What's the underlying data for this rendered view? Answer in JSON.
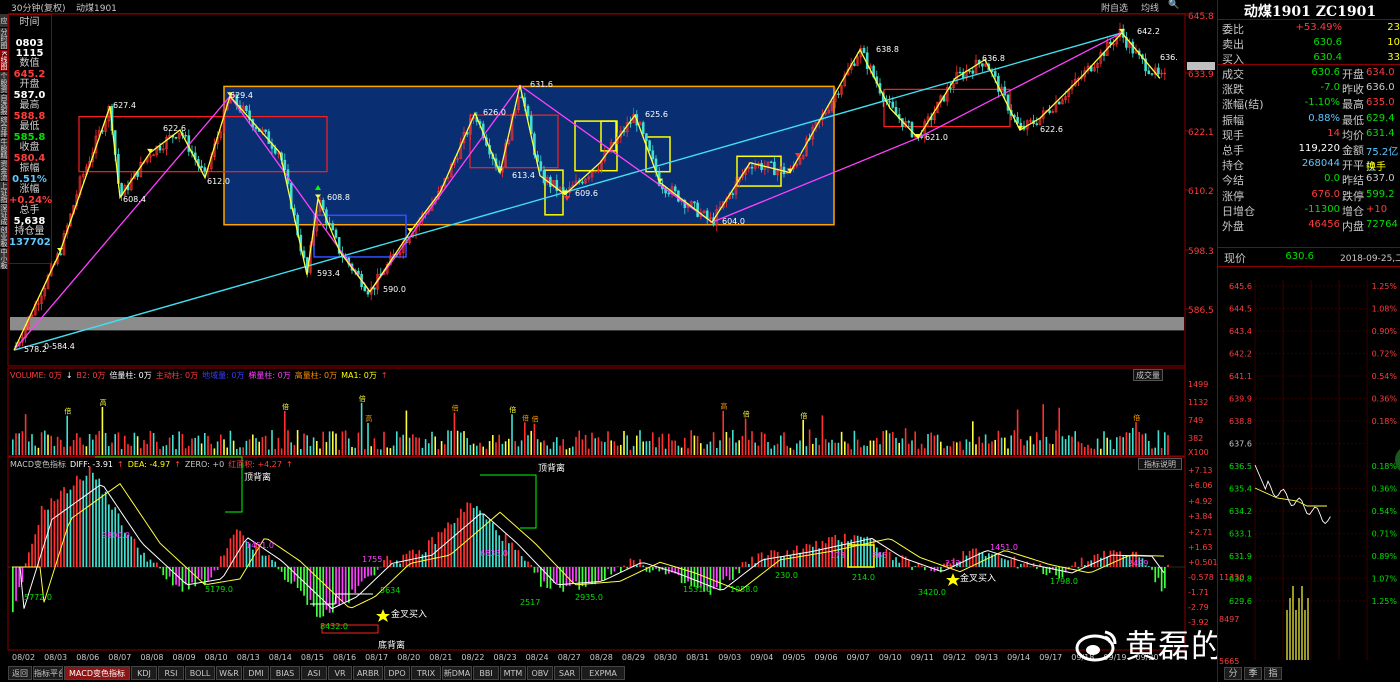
{
  "window": {
    "title": "30分钟(复权)",
    "symbol": "动煤1901",
    "toolbar": [
      "附自选",
      "均线",
      "🔍"
    ]
  },
  "side_tabs": [
    "应用",
    "分时图",
    "K线图",
    "个股资料",
    "自选报价",
    "综合排名",
    "牛股精选",
    "资金流向",
    "上证指数",
    "深证成指",
    "创业板指",
    "中小板指"
  ],
  "info_panel": [
    {
      "label": "时间",
      "value": "",
      "color": "#d0d0d0"
    },
    {
      "label": "",
      "value": "0803",
      "color": "#fff"
    },
    {
      "label": "",
      "value": "1115",
      "color": "#fff"
    },
    {
      "label": "数值",
      "value": "645.2",
      "color": "#ff3c3c"
    },
    {
      "label": "开盘",
      "value": "587.0",
      "color": "#fff"
    },
    {
      "label": "最高",
      "value": "588.8",
      "color": "#ff3c3c"
    },
    {
      "label": "最低",
      "value": "585.8",
      "color": "#00e000"
    },
    {
      "label": "收盘",
      "value": "580.4",
      "color": "#ff3c3c"
    },
    {
      "label": "振幅",
      "value": "0.51%",
      "color": "#5ec8ff"
    },
    {
      "label": "涨幅",
      "value": "+0.24%",
      "color": "#ff3c3c"
    },
    {
      "label": "总手",
      "value": "5,638",
      "color": "#fff"
    },
    {
      "label": "持仓量",
      "value": "137702",
      "color": "#5ec8ff"
    }
  ],
  "price_axis": [
    "645.8",
    "633.9",
    "622.1",
    "610.2",
    "598.3",
    "586.5"
  ],
  "kline_labels": [
    {
      "text": "627.4",
      "c": "#fff"
    },
    {
      "text": "622.6",
      "c": "#fff"
    },
    {
      "text": "608.4",
      "c": "#fff"
    },
    {
      "text": "612.0",
      "c": "#fff"
    },
    {
      "text": "629.4",
      "c": "#fff"
    },
    {
      "text": "608.8",
      "c": "#fff"
    },
    {
      "text": "593.4",
      "c": "#fff"
    },
    {
      "text": "590.0",
      "c": "#fff"
    },
    {
      "text": "626.0",
      "c": "#fff"
    },
    {
      "text": "631.6",
      "c": "#fff"
    },
    {
      "text": "613.4",
      "c": "#fff"
    },
    {
      "text": "609.6",
      "c": "#fff"
    },
    {
      "text": "625.6",
      "c": "#fff"
    },
    {
      "text": "604.0",
      "c": "#fff"
    },
    {
      "text": "638.8",
      "c": "#fff"
    },
    {
      "text": "621.0",
      "c": "#fff"
    },
    {
      "text": "636.8",
      "c": "#fff"
    },
    {
      "text": "622.6",
      "c": "#fff"
    },
    {
      "text": "642.2",
      "c": "#fff"
    },
    {
      "text": "636.",
      "c": "#fff"
    },
    {
      "text": "578.2",
      "c": "#fff"
    },
    {
      "text": "0-584.4",
      "c": "#fff"
    }
  ],
  "volume": {
    "header": [
      {
        "t": "VOLUME: 0万",
        "c": "#ff3c3c"
      },
      {
        "t": "↓",
        "c": "#fff"
      },
      {
        "t": "B2: 0万",
        "c": "#ff3c3c"
      },
      {
        "t": "倍量柱: 0万",
        "c": "#fff"
      },
      {
        "t": "主动柱: 0万",
        "c": "#ff3c3c"
      },
      {
        "t": "地域量: 0万",
        "c": "#3c3cff"
      },
      {
        "t": "梯量柱: 0万",
        "c": "#ff40ff"
      },
      {
        "t": "高量柱: 0万",
        "c": "#ff8c00"
      },
      {
        "t": "MA1: 0万",
        "c": "#ffff00"
      },
      {
        "t": "↑",
        "c": "#ff3c3c"
      }
    ],
    "button": "成交量",
    "axis": [
      "1499",
      "1132",
      "749",
      "382",
      "X100"
    ],
    "marker_gao": "高",
    "marker_bei": "倍"
  },
  "macd": {
    "header": [
      {
        "t": "MACD变色指标",
        "c": "#c8c8c8"
      },
      {
        "t": "DIFF: -3.91",
        "c": "#fff"
      },
      {
        "t": "↑",
        "c": "#ff3c3c"
      },
      {
        "t": "DEA: -4.97",
        "c": "#ffff00"
      },
      {
        "t": "↑",
        "c": "#ff3c3c"
      },
      {
        "t": "ZERO: +0",
        "c": "#c8c8c8"
      },
      {
        "t": "红面积: +4.27",
        "c": "#ff3c3c"
      },
      {
        "t": "↑",
        "c": "#ff3c3c"
      }
    ],
    "button": "指标说明",
    "axis": [
      "+7.13",
      "+6.06",
      "+4.92",
      "+3.84",
      "+2.71",
      "+1.63",
      "+0.501",
      "-0.578",
      "-1.71",
      "-2.79",
      "-3.92"
    ],
    "labels": [
      {
        "t": "顶背离",
        "c": "#fff"
      },
      {
        "t": "顶背离",
        "c": "#fff"
      },
      {
        "t": "底背离",
        "c": "#fff"
      },
      {
        "t": "金叉买入",
        "c": "#fff"
      },
      {
        "t": "金叉买入",
        "c": "#fff"
      },
      {
        "t": "5772.0",
        "c": "#00e000"
      },
      {
        "t": "9800.0",
        "c": "#ff40ff"
      },
      {
        "t": "5179.0",
        "c": "#00e000"
      },
      {
        "t": "1451.0",
        "c": "#ff40ff"
      },
      {
        "t": "8432.0",
        "c": "#00e000"
      },
      {
        "t": "1755",
        "c": "#ff40ff"
      },
      {
        "t": "5634",
        "c": "#00e000"
      },
      {
        "t": "6533.0",
        "c": "#ff40ff"
      },
      {
        "t": "2517",
        "c": "#00e000"
      },
      {
        "t": "2935.0",
        "c": "#00e000"
      },
      {
        "t": "1531.0",
        "c": "#00e000"
      },
      {
        "t": "1058.0",
        "c": "#00e000"
      },
      {
        "t": "230.0",
        "c": "#00e000"
      },
      {
        "t": "214.0",
        "c": "#00e000"
      },
      {
        "t": "3420.0",
        "c": "#00e000"
      },
      {
        "t": "1451.0",
        "c": "#ff40ff"
      },
      {
        "t": "1798.0",
        "c": "#00e000"
      },
      {
        "t": "2429",
        "c": "#ff40ff"
      },
      {
        "t": "173",
        "c": "#ff40ff"
      },
      {
        "t": "865",
        "c": "#ff40ff"
      },
      {
        "t": "233",
        "c": "#ff40ff"
      }
    ]
  },
  "dates": [
    "08/02",
    "08/03",
    "08/06",
    "08/07",
    "08/08",
    "08/09",
    "08/10",
    "08/13",
    "08/14",
    "08/15",
    "08/16",
    "08/17",
    "08/20",
    "08/21",
    "08/22",
    "08/23",
    "08/24",
    "08/27",
    "08/28",
    "08/29",
    "08/30",
    "08/31",
    "09/03",
    "09/04",
    "09/05",
    "09/06",
    "09/07",
    "09/10",
    "09/11",
    "09/12",
    "09/13",
    "09/14",
    "09/17",
    "09/18",
    "09/19",
    "09/20"
  ],
  "bottom_tabs": [
    "返回",
    "指标平台",
    "MACD变色指标",
    "KDJ",
    "RSI",
    "BOLL",
    "W&R",
    "DMI",
    "BIAS",
    "ASI",
    "VR",
    "ARBR",
    "DPO",
    "TRIX",
    "新DMA",
    "BBI",
    "MTM",
    "OBV",
    "SAR",
    "EXPMA"
  ],
  "bottom_active": "MACD变色指标",
  "watermark": "黄磊的期货人生",
  "quote": {
    "title": "动煤1901 ZC1901",
    "rows": [
      {
        "l": "委比",
        "v": "+53.49%",
        "vc": "#ff3c3c",
        "v2": "23",
        "v2c": "#ffff00"
      },
      {
        "l": "卖出",
        "v": "630.6",
        "vc": "#00e000",
        "v2": "10",
        "v2c": "#ffff00"
      },
      {
        "l": "买入",
        "v": "630.4",
        "vc": "#00e000",
        "v2": "33",
        "v2c": "#ffff00"
      }
    ],
    "grid": [
      {
        "l": "成交",
        "v": "630.6",
        "vc": "#00e000",
        "l2": "开盘",
        "v2": "634.0",
        "v2c": "#ff3c3c"
      },
      {
        "l": "涨跌",
        "v": "-7.0",
        "vc": "#00e000",
        "l2": "昨收",
        "v2": "636.0",
        "v2c": "#c8c8c8"
      },
      {
        "l": "涨幅(结)",
        "v": "-1.10%",
        "vc": "#00e000",
        "l2": "最高",
        "v2": "635.0",
        "v2c": "#ff3c3c"
      },
      {
        "l": "振幅",
        "v": "0.88%",
        "vc": "#5ec8ff",
        "l2": "最低",
        "v2": "629.4",
        "v2c": "#00e000"
      },
      {
        "l": "现手",
        "v": "14",
        "vc": "#ff3c3c",
        "l2": "均价",
        "v2": "631.4",
        "v2c": "#00e000"
      },
      {
        "l": "总手",
        "v": "119,220",
        "vc": "#fff",
        "l2": "金额",
        "v2": "75.2亿位",
        "v2c": "#5ec8ff"
      },
      {
        "l": "持仓",
        "v": "268044",
        "vc": "#5ec8ff",
        "l2": "开平",
        "v2": "换手",
        "v2c": "#ffff00"
      },
      {
        "l": "今结",
        "v": "0.0",
        "vc": "#00e000",
        "l2": "昨结",
        "v2": "637.0",
        "v2c": "#c8c8c8"
      },
      {
        "l": "涨停",
        "v": "676.0",
        "vc": "#ff3c3c",
        "l2": "跌停",
        "v2": "599.2",
        "v2c": "#00e000"
      },
      {
        "l": "日增仓",
        "v": "-11300",
        "vc": "#00e000",
        "l2": "增仓",
        "v2": "+10",
        "v2c": "#ff3c3c"
      },
      {
        "l": "外盘",
        "v": "46456",
        "vc": "#ff3c3c",
        "l2": "内盘",
        "v2": "72764",
        "v2c": "#00e000"
      }
    ],
    "last": {
      "l": "现价",
      "v": "630.6",
      "vc": "#00e000",
      "time": "2018-09-25,二"
    },
    "mini_axis": [
      "645.6",
      "644.5",
      "643.4",
      "642.2",
      "641.1",
      "639.9",
      "638.8",
      "637.6",
      "636.5",
      "635.4",
      "634.2",
      "633.1",
      "631.9",
      "630.8",
      "629.6"
    ],
    "mini_pct": [
      "1.25%",
      "1.08%",
      "0.90%",
      "0.72%",
      "0.54%",
      "0.36%",
      "0.18%",
      "",
      "0.18%",
      "0.36%",
      "0.54%",
      "0.71%",
      "0.89%",
      "1.07%",
      "1.25%"
    ],
    "mini_vol": [
      "11330",
      "8497",
      "5665"
    ],
    "bottom_tabs": [
      "分",
      "季",
      "指"
    ]
  }
}
